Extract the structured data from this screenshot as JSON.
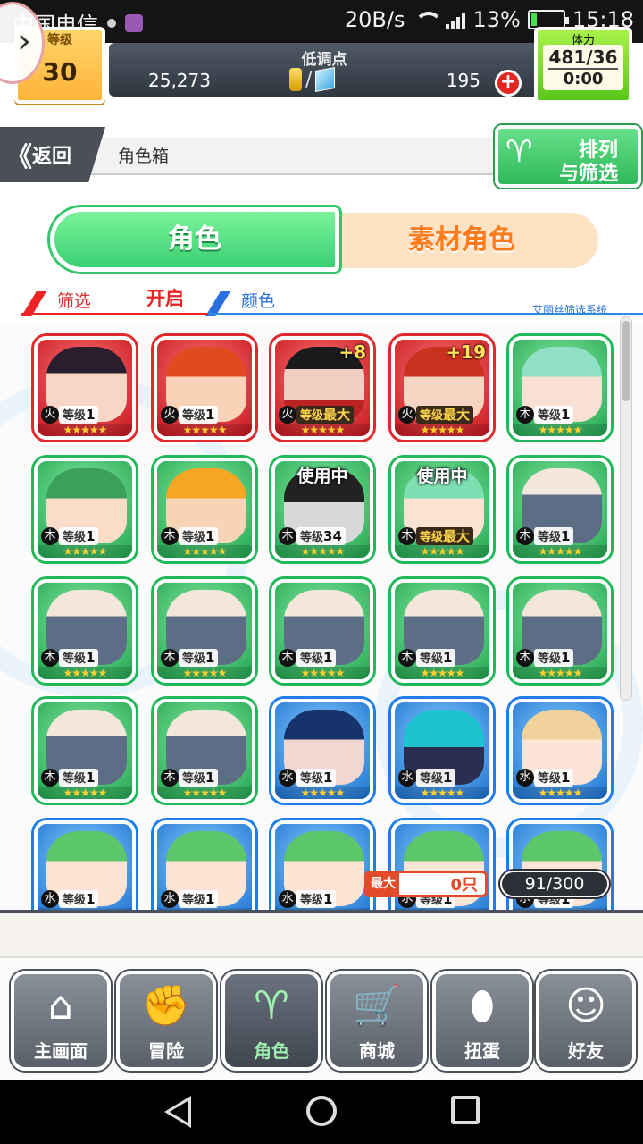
{
  "status_bar": {
    "carrier": "中国电信",
    "speed": "20B/s",
    "network": "4G 2G",
    "battery": "13%",
    "time": "15:18"
  },
  "hud": {
    "level_label": "等级",
    "level": "30",
    "currency_title": "低调点",
    "coins": "25,273",
    "slash": "/",
    "gems": "195",
    "plus": "+",
    "stamina_label": "体力",
    "stamina": "481/36",
    "stamina_timer": "0:00"
  },
  "nav_row": {
    "back_label": "返回",
    "back_chevron": "《",
    "breadcrumb": "角色箱",
    "sort_line1": "排列",
    "sort_line2": "与筛选"
  },
  "tabs": {
    "character": "角色",
    "material": "素材角色"
  },
  "filter": {
    "filter_label": "筛选",
    "filter_state": "开启",
    "color_label": "颜色",
    "system_label": "艾丽丝筛选系统"
  },
  "grid": {
    "level_prefix": "等级",
    "stars": "★★★★★",
    "cards": [
      {
        "color": "red",
        "face": "a",
        "elem": "火",
        "level": "1"
      },
      {
        "color": "red",
        "face": "b",
        "elem": "火",
        "level": "1"
      },
      {
        "color": "red",
        "face": "c",
        "elem": "火",
        "level": "最大",
        "max": true,
        "badge": "+8"
      },
      {
        "color": "red",
        "face": "d",
        "elem": "火",
        "level": "最大",
        "max": true,
        "badge": "+19"
      },
      {
        "color": "green",
        "face": "e",
        "elem": "木",
        "level": "1"
      },
      {
        "color": "green",
        "face": "f",
        "elem": "木",
        "level": "1"
      },
      {
        "color": "green",
        "face": "g",
        "elem": "木",
        "level": "1"
      },
      {
        "color": "green",
        "face": "h",
        "elem": "木",
        "level": "34",
        "inuse": "使用中"
      },
      {
        "color": "green",
        "face": "i",
        "elem": "木",
        "level": "最大",
        "max": true,
        "inuse": "使用中"
      },
      {
        "color": "green",
        "face": "j",
        "elem": "木",
        "level": "1"
      },
      {
        "color": "green",
        "face": "j",
        "elem": "木",
        "level": "1"
      },
      {
        "color": "green",
        "face": "j",
        "elem": "木",
        "level": "1"
      },
      {
        "color": "green",
        "face": "j",
        "elem": "木",
        "level": "1"
      },
      {
        "color": "green",
        "face": "j",
        "elem": "木",
        "level": "1"
      },
      {
        "color": "green",
        "face": "j",
        "elem": "木",
        "level": "1"
      },
      {
        "color": "green",
        "face": "j",
        "elem": "木",
        "level": "1"
      },
      {
        "color": "green",
        "face": "j",
        "elem": "木",
        "level": "1"
      },
      {
        "color": "blue",
        "face": "k",
        "elem": "水",
        "level": "1"
      },
      {
        "color": "blue",
        "face": "l",
        "elem": "水",
        "level": "1"
      },
      {
        "color": "blue",
        "face": "m",
        "elem": "水",
        "level": "1"
      },
      {
        "color": "blue",
        "face": "n",
        "elem": "水",
        "level": "1"
      },
      {
        "color": "blue",
        "face": "n",
        "elem": "水",
        "level": "1"
      },
      {
        "color": "blue",
        "face": "n",
        "elem": "水",
        "level": "1"
      },
      {
        "color": "blue",
        "face": "n",
        "elem": "水",
        "level": "1"
      },
      {
        "color": "blue",
        "face": "n",
        "elem": "水",
        "level": "1"
      }
    ]
  },
  "counters": {
    "max_tag": "最大",
    "max_count": "0只",
    "box_count": "91/300"
  },
  "bottom_nav": [
    {
      "label": "主画面",
      "icon": "home-icon",
      "glyph": "⌂"
    },
    {
      "label": "冒险",
      "icon": "handshake-icon",
      "glyph": "✊"
    },
    {
      "label": "角色",
      "icon": "rabbit-icon",
      "glyph": "♈",
      "active": true
    },
    {
      "label": "商城",
      "icon": "cart-icon",
      "glyph": "🛒"
    },
    {
      "label": "扭蛋",
      "icon": "egg-icon",
      "glyph": "⬮"
    },
    {
      "label": "好友",
      "icon": "friends-icon",
      "glyph": "☺"
    }
  ]
}
